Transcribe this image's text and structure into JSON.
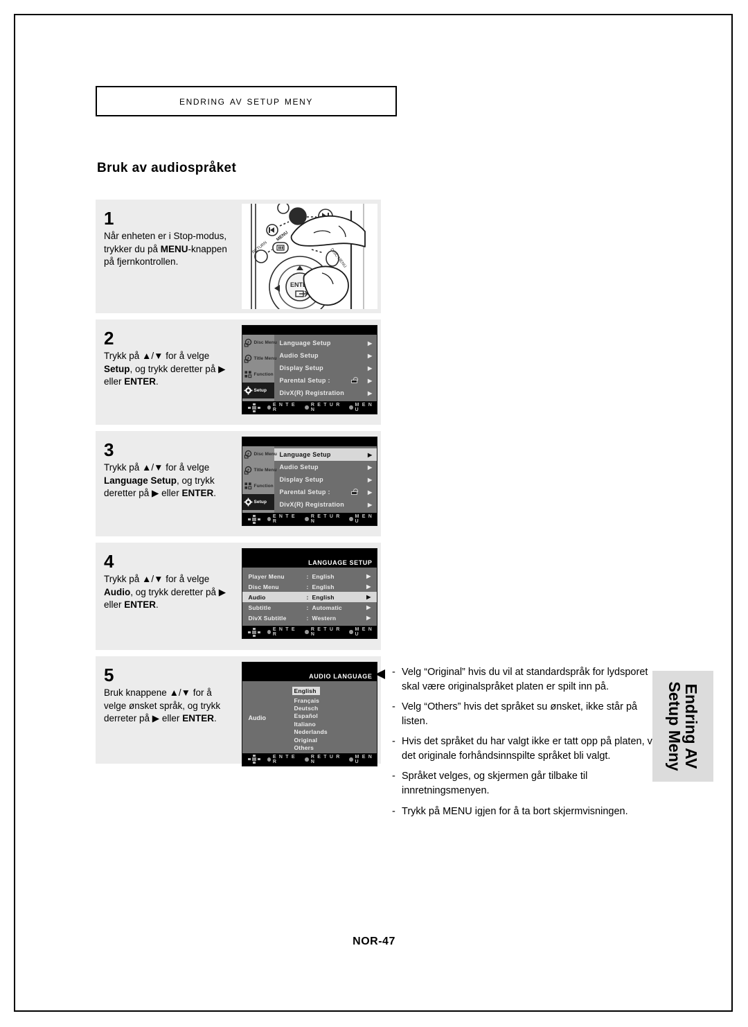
{
  "page": {
    "chapter_title": "Endring av Setup Meny",
    "section_title": "Bruk av audiospråket",
    "footer": "NOR-47",
    "side_tab_line1": "Endring AV",
    "side_tab_line2": "Setup Meny"
  },
  "steps": [
    {
      "number": "1",
      "text_parts": [
        {
          "t": "Når enheten er i Stop-modus, trykker du på ",
          "b": false
        },
        {
          "t": "MENU",
          "b": true
        },
        {
          "t": "-knappen på fjernkontrollen.",
          "b": false
        }
      ],
      "visual": "remote-control"
    },
    {
      "number": "2",
      "text_parts": [
        {
          "t": "Trykk på ▲/▼ for å velge ",
          "b": false
        },
        {
          "t": "Setup",
          "b": true
        },
        {
          "t": ", og trykk deretter på ▶ eller ",
          "b": false
        },
        {
          "t": "ENTER",
          "b": true
        },
        {
          "t": ".",
          "b": false
        }
      ],
      "visual": "setup-menu"
    },
    {
      "number": "3",
      "text_parts": [
        {
          "t": "Trykk på ▲/▼ for å velge ",
          "b": false
        },
        {
          "t": "Language Setup",
          "b": true
        },
        {
          "t": ", og trykk deretter på ▶ eller ",
          "b": false
        },
        {
          "t": "ENTER",
          "b": true
        },
        {
          "t": ".",
          "b": false
        }
      ],
      "visual": "setup-menu-selected"
    },
    {
      "number": "4",
      "text_parts": [
        {
          "t": "Trykk på ▲/▼ for å velge ",
          "b": false
        },
        {
          "t": "Audio",
          "b": true
        },
        {
          "t": ", og trykk deretter på ▶ eller ",
          "b": false
        },
        {
          "t": "ENTER",
          "b": true
        },
        {
          "t": ".",
          "b": false
        }
      ],
      "visual": "language-setup"
    },
    {
      "number": "5",
      "text_parts": [
        {
          "t": "Bruk knappene ▲/▼ for å velge ønsket språk, og trykk derreter på ▶ eller ",
          "b": false
        },
        {
          "t": "ENTER",
          "b": true
        },
        {
          "t": ".",
          "b": false
        }
      ],
      "visual": "audio-language"
    }
  ],
  "osd": {
    "sidebar": [
      {
        "label": "Disc Menu",
        "icon": "disc-menu-icon",
        "active": false
      },
      {
        "label": "Title Menu",
        "icon": "title-menu-icon",
        "active": false
      },
      {
        "label": "Function",
        "icon": "function-icon",
        "active": false
      },
      {
        "label": "Setup",
        "icon": "gear-icon",
        "active": true
      }
    ],
    "setup_rows": [
      {
        "label": "Language Setup",
        "arrow": "▶",
        "lock": false
      },
      {
        "label": "Audio Setup",
        "arrow": "▶",
        "lock": false
      },
      {
        "label": "Display Setup",
        "arrow": "▶",
        "lock": false
      },
      {
        "label": "Parental Setup :",
        "arrow": "▶",
        "lock": true
      },
      {
        "label": "DivX(R) Registration",
        "arrow": "▶",
        "lock": false
      }
    ],
    "setup_selected_index": 0,
    "language_setup": {
      "title": "LANGUAGE SETUP",
      "rows": [
        {
          "name": "Player Menu",
          "sep": ":",
          "value": "English",
          "arrow": "▶"
        },
        {
          "name": "Disc Menu",
          "sep": ":",
          "value": "English",
          "arrow": "▶"
        },
        {
          "name": "Audio",
          "sep": ":",
          "value": "English",
          "arrow": "▶"
        },
        {
          "name": "Subtitle",
          "sep": ":",
          "value": "Automatic",
          "arrow": "▶"
        },
        {
          "name": "DivX Subtitle",
          "sep": ":",
          "value": "Western",
          "arrow": "▶"
        }
      ],
      "selected_index": 2
    },
    "audio_language": {
      "title": "AUDIO LANGUAGE",
      "left_label": "Audio",
      "options": [
        "English",
        "Français",
        "Deutsch",
        "Español",
        "Italiano",
        "Nederlands",
        "Original",
        "Others"
      ],
      "selected_index": 0
    },
    "bottom_bar": {
      "dpad": "dpad-icon",
      "buttons": [
        "E N T E R",
        "R E T U R N",
        "M E N U"
      ]
    }
  },
  "remote": {
    "buttons": [
      "MENU",
      "RETURN",
      "DISC MENU",
      "ENTER"
    ]
  },
  "notes": [
    "Velg “Original” hvis du vil at standardspråk for lydsporet skal være originalspråket platen er spilt inn på.",
    "Velg “Others” hvis det språket su ønsket, ikke står på listen.",
    "Hvis det språket du har valgt ikke er tatt opp på platen, vil det originale forhåndsinnspilte språket bli valgt.",
    "Språket velges, og skjermen går tilbake til innretningsmenyen.",
    "Trykk på MENU igjen for å ta bort skjermvisningen."
  ],
  "note_dash": "-"
}
